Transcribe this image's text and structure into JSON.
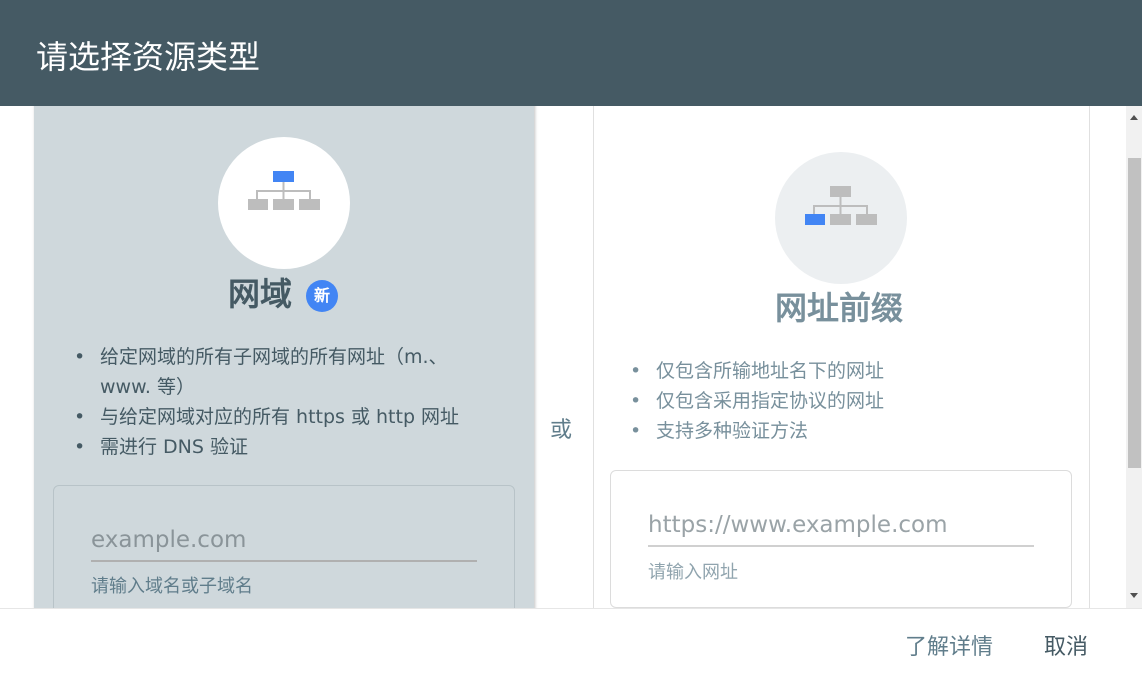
{
  "header": {
    "title": "请选择资源类型"
  },
  "domain_card": {
    "title": "网域",
    "badge": "新",
    "bullets": [
      "给定网域的所有子网域的所有网址（m.、www. 等）",
      "与给定网域对应的所有 https 或 http 网址",
      "需进行 DNS 验证"
    ],
    "input_placeholder": "example.com",
    "input_hint": "请输入域名或子域名",
    "icon": "sitemap-icon-top-highlight"
  },
  "separator": {
    "label": "或"
  },
  "url_card": {
    "title": "网址前缀",
    "bullets": [
      "仅包含所输地址名下的网址",
      "仅包含采用指定协议的网址",
      "支持多种验证方法"
    ],
    "input_placeholder": "https://www.example.com",
    "input_hint": "请输入网址",
    "icon": "sitemap-icon-leaf-highlight"
  },
  "footer": {
    "learn_more_label": "了解详情",
    "cancel_label": "取消"
  },
  "colors": {
    "header_bg": "#455a64",
    "domain_card_bg": "#cfd8dc",
    "accent_blue": "#4285f4",
    "icon_gray": "#bdbdbd"
  }
}
